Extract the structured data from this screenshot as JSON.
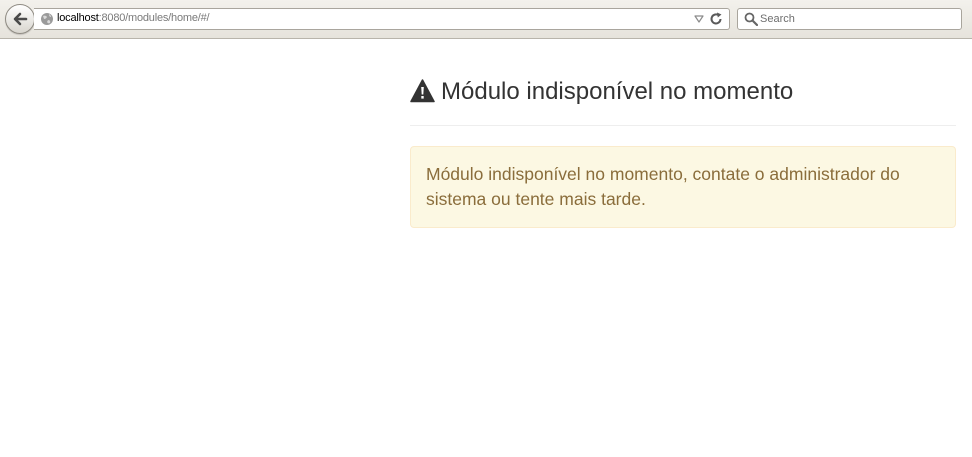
{
  "browser": {
    "url": {
      "host": "localhost",
      "rest": ":8080/modules/home/#/"
    },
    "search": {
      "placeholder": "Search"
    },
    "icons": {
      "back": "back-arrow-icon",
      "site": "globe-icon",
      "dropmarker": "dropdown-triangle-icon",
      "reload": "reload-icon",
      "search": "magnifier-icon"
    }
  },
  "page": {
    "title": "Módulo indisponível no momento",
    "title_icon": "warning-icon",
    "alert": {
      "message": "Módulo indisponível no momento, contate o administrador do sistema ou tente mais tarde."
    }
  },
  "colors": {
    "alert_background": "#fcf8e3",
    "alert_border": "#faebcc",
    "alert_text": "#8a6d3b",
    "title_text": "#333333"
  }
}
